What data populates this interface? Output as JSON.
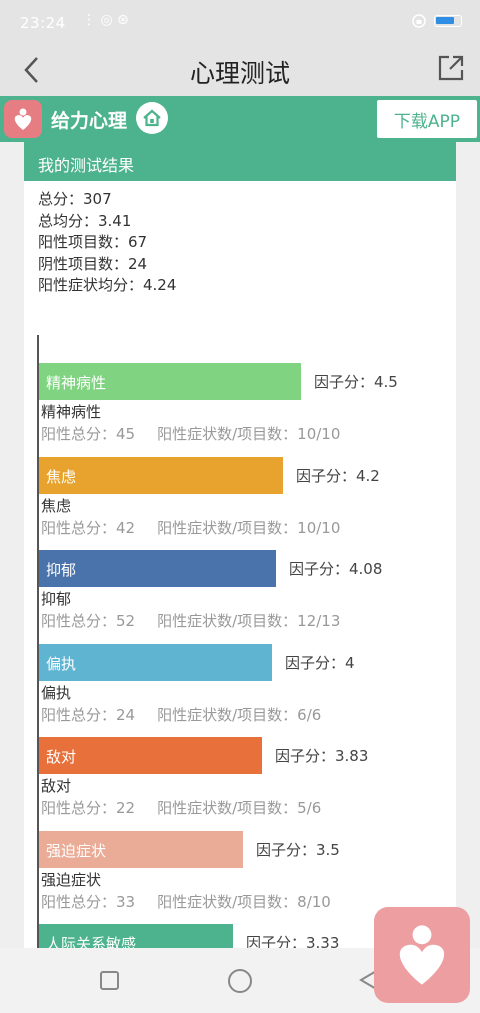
{
  "status": {
    "time": "23:24",
    "sys_icons": "⋮ ◎ ⊛"
  },
  "nav": {
    "title": "心理测试"
  },
  "brand": {
    "name": "给力心理",
    "download": "下载APP"
  },
  "result": {
    "header": "我的测试结果",
    "summary": [
      "总分：307",
      "总均分：3.41",
      "阳性项目数：67",
      "阴性项目数：24",
      "阳性症状均分：4.24"
    ]
  },
  "colors": {
    "brand_green": "#4db38e",
    "logo_pink": "#e67d83",
    "factor_colors": [
      "#7fd381",
      "#e8a32f",
      "#4a73ab",
      "#5fb4d2",
      "#e8713b",
      "#eaac96",
      "#4db38e"
    ]
  },
  "chart_data": {
    "type": "bar",
    "orientation": "horizontal",
    "categories": [
      "精神病性",
      "焦虑",
      "抑郁",
      "偏执",
      "敌对",
      "强迫症状",
      "人际关系敏感"
    ],
    "values": [
      4.5,
      4.2,
      4.08,
      4,
      3.83,
      3.5,
      3.33
    ]
  },
  "factors": [
    {
      "label": "精神病性",
      "score": "因子分：4.5",
      "name": "精神病性",
      "total": "阳性总分：45",
      "ratio": "阳性症状数/项目数：10/10"
    },
    {
      "label": "焦虑",
      "score": "因子分：4.2",
      "name": "焦虑",
      "total": "阳性总分：42",
      "ratio": "阳性症状数/项目数：10/10"
    },
    {
      "label": "抑郁",
      "score": "因子分：4.08",
      "name": "抑郁",
      "total": "阳性总分：52",
      "ratio": "阳性症状数/项目数：12/13"
    },
    {
      "label": "偏执",
      "score": "因子分：4",
      "name": "偏执",
      "total": "阳性总分：24",
      "ratio": "阳性症状数/项目数：6/6"
    },
    {
      "label": "敌对",
      "score": "因子分：3.83",
      "name": "敌对",
      "total": "阳性总分：22",
      "ratio": "阳性症状数/项目数：5/6"
    },
    {
      "label": "强迫症状",
      "score": "因子分：3.5",
      "name": "强迫症状",
      "total": "阳性总分：33",
      "ratio": "阳性症状数/项目数：8/10"
    },
    {
      "label": "人际关系敏感",
      "score": "因子分：3.33",
      "name": "",
      "total": "",
      "ratio": ""
    }
  ]
}
